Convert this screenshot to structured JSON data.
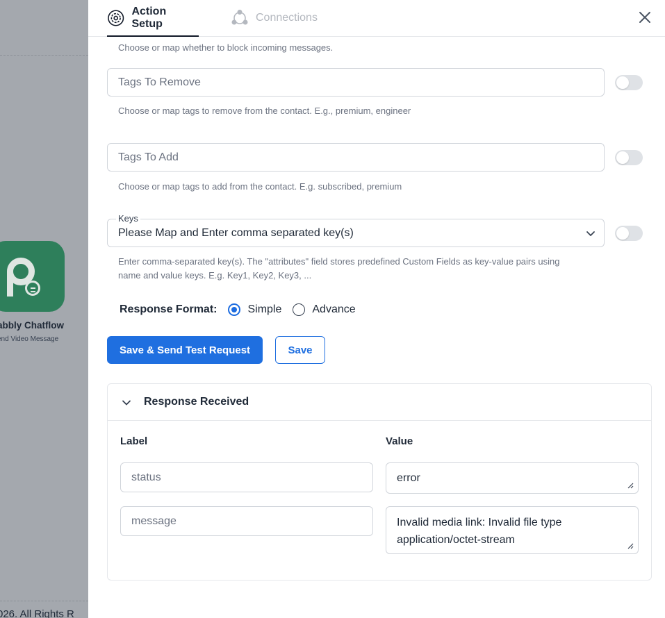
{
  "background": {
    "app_name": "abbly Chatflow",
    "app_subtitle": "end Video Message",
    "footer": "026. All Rights R"
  },
  "tabs": {
    "action_setup": "Action Setup",
    "connections": "Connections"
  },
  "form": {
    "block_hint": "Choose or map whether to block incoming messages.",
    "tags_remove": {
      "placeholder": "Tags To Remove",
      "hint": "Choose or map tags to remove from the contact. E.g., premium, engineer"
    },
    "tags_add": {
      "placeholder": "Tags To Add",
      "hint": "Choose or map tags to add from the contact. E.g. subscribed, premium"
    },
    "keys": {
      "label": "Keys",
      "value": "Please Map and Enter comma separated key(s)",
      "hint_line1": "Enter comma-separated key(s). The \"attributes\" field stores predefined Custom Fields as key-value pairs using",
      "hint_line2": "name and value keys. E.g. Key1, Key2, Key3, ..."
    },
    "response_format": {
      "label": "Response Format:",
      "options": [
        "Simple",
        "Advance"
      ],
      "selected": "Simple"
    }
  },
  "buttons": {
    "save_test": "Save & Send Test Request",
    "save": "Save"
  },
  "response": {
    "title": "Response Received",
    "label_header": "Label",
    "value_header": "Value",
    "rows": [
      {
        "label": "status",
        "value": "error"
      },
      {
        "label": "message",
        "value_line1": "Invalid media link: Invalid file type",
        "value_line2": "application/octet-stream"
      }
    ]
  },
  "colors": {
    "accent": "#1f6fe0",
    "brand_green": "#2e7f5b"
  }
}
